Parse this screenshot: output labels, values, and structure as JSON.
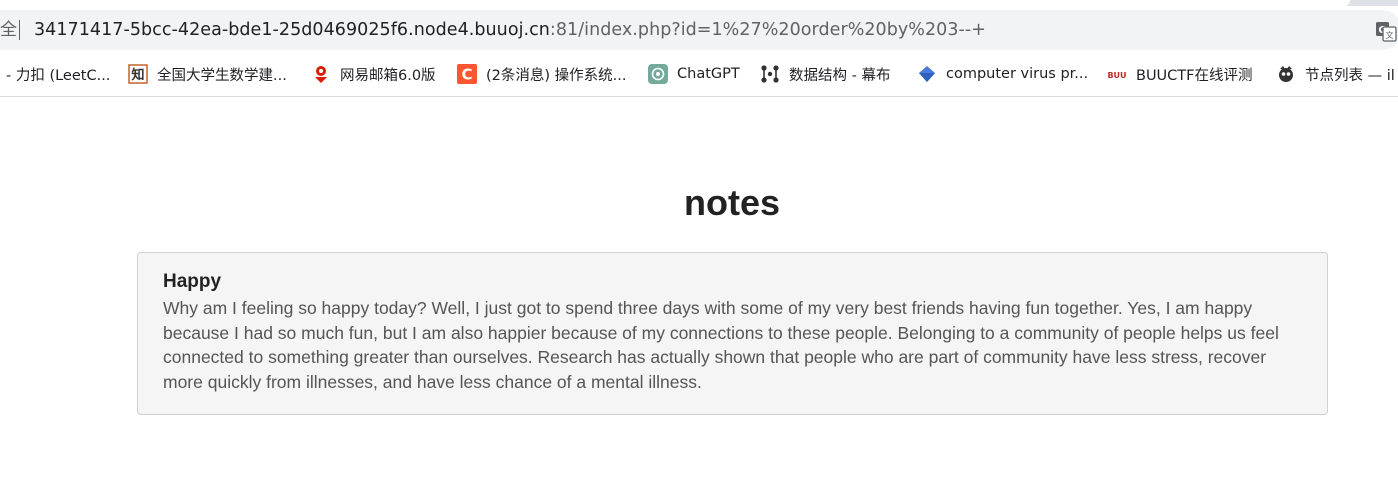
{
  "browser": {
    "security_label": "全",
    "url_host": "34171417-5bcc-42ea-bde1-25d0469025f6.node4.buuoj.cn",
    "url_rest": ":81/index.php?id=1%27%20order%20by%203--+",
    "translate_icon": "translate-icon"
  },
  "bookmarks": [
    {
      "label": "- 力扣 (LeetC...",
      "icon": "leetcode-icon"
    },
    {
      "label": "全国大学生数学建...",
      "icon": "zhihu-icon"
    },
    {
      "label": "网易邮箱6.0版",
      "icon": "netease-mail-icon"
    },
    {
      "label": "(2条消息) 操作系统...",
      "icon": "csdn-icon"
    },
    {
      "label": "ChatGPT",
      "icon": "chatgpt-icon"
    },
    {
      "label": "数据结构 - 幕布",
      "icon": "mubu-icon"
    },
    {
      "label": "computer virus pr...",
      "icon": "diamond-icon"
    },
    {
      "label": "BUUCTF在线评测",
      "icon": "buuctf-icon"
    },
    {
      "label": "节点列表 — il",
      "icon": "node-list-icon"
    }
  ],
  "page": {
    "title": "notes",
    "note": {
      "title": "Happy",
      "body": "Why am I feeling so happy today? Well, I just got to spend three days with some of my very best friends having fun together. Yes, I am happy because I had so much fun, but I am also happier because of my connections to these people. Belonging to a community of people helps us feel connected to something greater than ourselves. Research has actually shown that people who are part of community have less stress, recover more quickly from illnesses, and have less chance of a mental illness."
    }
  },
  "colors": {
    "card_background": "#f5f5f5",
    "card_border": "#d0d0d0",
    "body_text": "#555555",
    "heading_text": "#222222"
  }
}
